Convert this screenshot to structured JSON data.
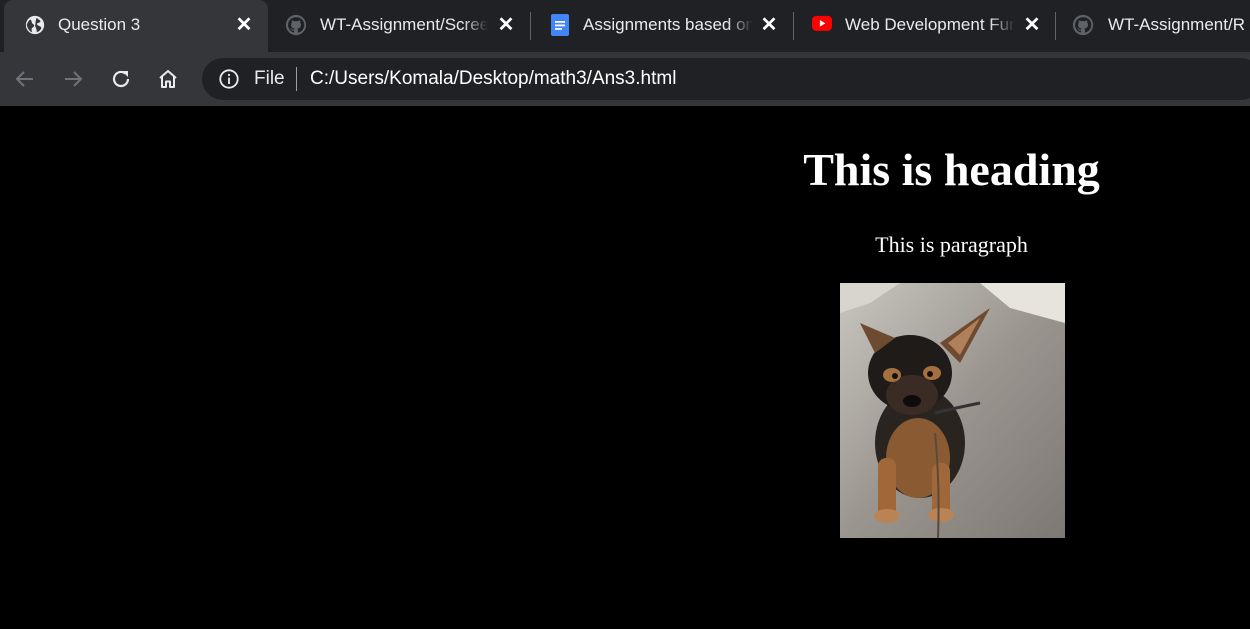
{
  "tabs": [
    {
      "title": "Question 3",
      "favicon": "globe-icon",
      "active": true
    },
    {
      "title": "WT-Assignment/Screenshots",
      "favicon": "github-icon",
      "active": false
    },
    {
      "title": "Assignments based on",
      "favicon": "google-docs-icon",
      "active": false
    },
    {
      "title": "Web Development Fundamentals",
      "favicon": "youtube-icon",
      "active": false
    },
    {
      "title": "WT-Assignment/R",
      "favicon": "github-icon",
      "active": false
    }
  ],
  "toolbar": {
    "back_icon": "arrow-left-icon",
    "forward_icon": "arrow-right-icon",
    "reload_icon": "reload-icon",
    "home_icon": "home-icon"
  },
  "omnibox": {
    "security_label": "File",
    "url": "C:/Users/Komala/Desktop/math3/Ans3.html"
  },
  "page": {
    "background": "#000000",
    "heading": "This is heading",
    "paragraph": "This is paragraph",
    "image": "puppy-photo"
  },
  "colors": {
    "tabstrip": "#202124",
    "active_tab": "#35363a",
    "omnibox": "#202124",
    "youtube": "#ff0000",
    "docs": "#4285f4"
  }
}
